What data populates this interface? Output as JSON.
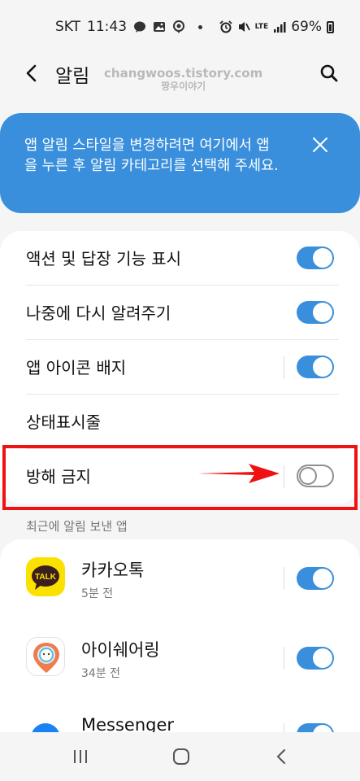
{
  "status_bar": {
    "carrier": "SKT",
    "time": "11:43",
    "network": "LTE",
    "battery_percent": "69%"
  },
  "header": {
    "title": "알림",
    "watermark_line1": "changwoos.tistory.com",
    "watermark_line2": "짱우이야기"
  },
  "banner": {
    "text": "앱 알림 스타일을 변경하려면 여기에서 앱을 누른 후 알림 카테고리를 선택해 주세요."
  },
  "settings": {
    "items": [
      {
        "label": "액션 및 답장 기능 표시",
        "enabled": true
      },
      {
        "label": "나중에 다시 알려주기",
        "enabled": true
      },
      {
        "label": "앱 아이콘 배지",
        "enabled": true
      },
      {
        "label": "상태표시줄"
      },
      {
        "label": "방해 금지",
        "enabled": false
      }
    ]
  },
  "recent_apps": {
    "header": "최근에 알림 보낸 앱",
    "items": [
      {
        "name": "카카오톡",
        "time": "5분 전",
        "icon_text": "TALK",
        "enabled": true
      },
      {
        "name": "아이쉐어링",
        "time": "34분 전",
        "enabled": true
      },
      {
        "name": "Messenger",
        "enabled": true
      }
    ]
  },
  "colors": {
    "accent": "#3a8fdc",
    "highlight": "#ee1212",
    "kakao_yellow": "#fae100"
  },
  "icons": {
    "back": "back-arrow-icon",
    "search": "search-icon",
    "close": "close-icon",
    "nav_recent": "recent-apps-icon",
    "nav_home": "home-icon",
    "nav_back": "back-icon"
  }
}
